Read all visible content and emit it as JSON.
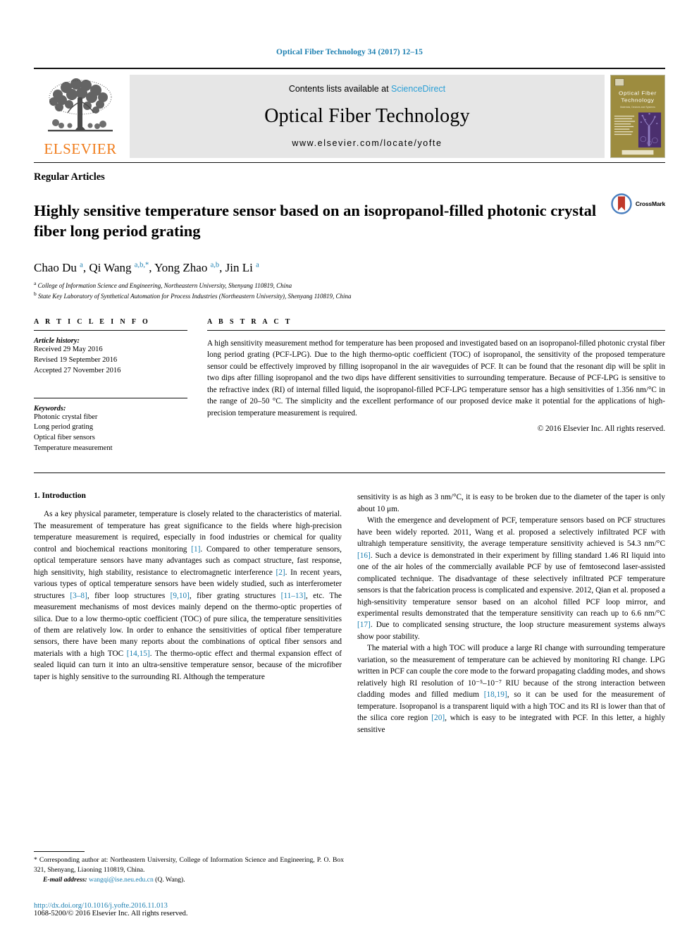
{
  "running_head": "Optical Fiber Technology 34 (2017) 12–15",
  "masthead": {
    "publisher_name": "ELSEVIER",
    "contents_prefix": "Contents lists available at ",
    "sciencedirect": "ScienceDirect",
    "journal_name": "Optical Fiber Technology",
    "journal_url": "www.elsevier.com/locate/yofte",
    "cover": {
      "title_line1": "Optical Fiber",
      "title_line2": "Technology",
      "subtitle": "Materials, Devices and Systems"
    }
  },
  "article": {
    "kicker": "Regular Articles",
    "title": "Highly sensitive temperature sensor based on an isopropanol-filled photonic crystal fiber long period grating",
    "crossmark_label": "CrossMark",
    "authors_html": "Chao Du <sup>a</sup>, Qi Wang <sup>a,b,*</sup>, Yong Zhao <sup>a,b</sup>, Jin Li <sup>a</sup>",
    "affiliations": [
      "College of Information Science and Engineering, Northeastern University, Shenyang 110819, China",
      "State Key Laboratory of Synthetical Automation for Process Industries (Northeastern University), Shenyang 110819, China"
    ]
  },
  "info": {
    "heading": "A R T I C L E   I N F O",
    "history_title": "Article history:",
    "history": [
      "Received 29 May 2016",
      "Revised 19 September 2016",
      "Accepted 27 November 2016"
    ],
    "keywords_title": "Keywords:",
    "keywords": [
      "Photonic crystal fiber",
      "Long period grating",
      "Optical fiber sensors",
      "Temperature measurement"
    ]
  },
  "abstract": {
    "heading": "A B S T R A C T",
    "text": "A high sensitivity measurement method for temperature has been proposed and investigated based on an isopropanol-filled photonic crystal fiber long period grating (PCF-LPG). Due to the high thermo-optic coefficient (TOC) of isopropanol, the sensitivity of the proposed temperature sensor could be effectively improved by filling isopropanol in the air waveguides of PCF. It can be found that the resonant dip will be split in two dips after filling isopropanol and the two dips have different sensitivities to surrounding temperature. Because of PCF-LPG is sensitive to the refractive index (RI) of internal filled liquid, the isopropanol-filled PCF-LPG temperature sensor has a high sensitivities of 1.356 nm/°C in the range of 20–50 °C. The simplicity and the excellent performance of our proposed device make it potential for the applications of high-precision temperature measurement is required.",
    "copyright": "© 2016 Elsevier Inc. All rights reserved."
  },
  "body": {
    "section_heading": "1. Introduction",
    "left_paragraphs": [
      "As a key physical parameter, temperature is closely related to the characteristics of material. The measurement of temperature has great significance to the fields where high-precision temperature measurement is required, especially in food industries or chemical for quality control and biochemical reactions monitoring [1]. Compared to other temperature sensors, optical temperature sensors have many advantages such as compact structure, fast response, high sensitivity, high stability, resistance to electromagnetic interference [2]. In recent years, various types of optical temperature sensors have been widely studied, such as interferometer structures [3–8], fiber loop structures [9,10], fiber grating structures [11–13], etc. The measurement mechanisms of most devices mainly depend on the thermo-optic properties of silica. Due to a low thermo-optic coefficient (TOC) of pure silica, the temperature sensitivities of them are relatively low. In order to enhance the sensitivities of optical fiber temperature sensors, there have been many reports about the combinations of optical fiber sensors and materials with a high TOC [14,15]. The thermo-optic effect and thermal expansion effect of sealed liquid can turn it into an ultra-sensitive temperature sensor, because of the microfiber taper is highly sensitive to the surrounding RI. Although the temperature"
    ],
    "right_paragraphs": [
      "sensitivity is as high as 3 nm/°C, it is easy to be broken due to the diameter of the taper is only about 10 μm.",
      "With the emergence and development of PCF, temperature sensors based on PCF structures have been widely reported. 2011, Wang et al. proposed a selectively infiltrated PCF with ultrahigh temperature sensitivity, the average temperature sensitivity achieved is 54.3 nm/°C [16]. Such a device is demonstrated in their experiment by filling standard 1.46 RI liquid into one of the air holes of the commercially available PCF by use of femtosecond laser-assisted complicated technique. The disadvantage of these selectively infiltrated PCF temperature sensors is that the fabrication process is complicated and expensive. 2012, Qian et al. proposed a high-sensitivity temperature sensor based on an alcohol filled PCF loop mirror, and experimental results demonstrated that the temperature sensitivity can reach up to 6.6 nm/°C [17]. Due to complicated sensing structure, the loop structure measurement systems always show poor stability.",
      "The material with a high TOC will produce a large RI change with surrounding temperature variation, so the measurement of temperature can be achieved by monitoring RI change. LPG written in PCF can couple the core mode to the forward propagating cladding modes, and shows relatively high RI resolution of 10⁻⁵–10⁻⁷ RIU because of the strong interaction between cladding modes and filled medium [18,19], so it can be used for the measurement of temperature. Isopropanol is a transparent liquid with a high TOC and its RI is lower than that of the silica core region [20], which is easy to be integrated with PCF. In this letter, a highly sensitive"
    ]
  },
  "footnote": {
    "corresponding": "* Corresponding author at: Northeastern University, College of Information Science and Engineering, P. O. Box 321, Shenyang, Liaoning 110819, China.",
    "email_label": "E-mail address:",
    "email": "wangqi@ise.neu.edu.cn",
    "email_suffix": "(Q. Wang)."
  },
  "footer": {
    "doi": "http://dx.doi.org/10.1016/j.yofte.2016.11.013",
    "issn": "1068-5200/© 2016 Elsevier Inc. All rights reserved."
  },
  "colors": {
    "link_blue": "#1a7eb0",
    "sciencedirect_blue": "#2a9fd6",
    "elsevier_orange": "#f07c1b",
    "cover_gold": "#9d8c3f",
    "cover_purple": "#4b2f6e"
  }
}
